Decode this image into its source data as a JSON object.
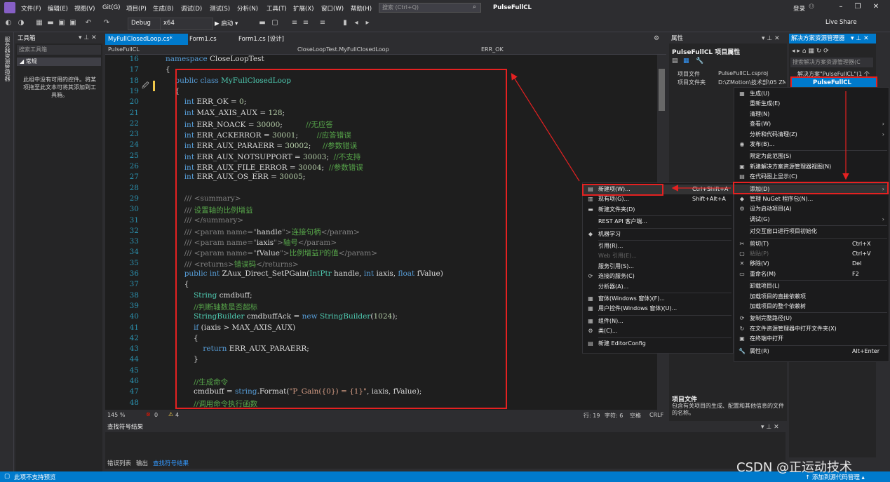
{
  "menubar": {
    "items": [
      "文件(F)",
      "编辑(E)",
      "视图(V)",
      "Git(G)",
      "项目(P)",
      "生成(B)",
      "调试(D)",
      "测试(S)",
      "分析(N)",
      "工具(T)",
      "扩展(X)",
      "窗口(W)",
      "帮助(H)"
    ],
    "search_placeholder": "搜索 (Ctrl+Q)",
    "title": "PulseFullCL",
    "login": "登录"
  },
  "toolbar": {
    "config": "Debug",
    "platform": "x64",
    "start": "▶ 启动 ▾",
    "liveshare": "Live Share"
  },
  "left_strip": {
    "label": "服务器资源管理器"
  },
  "toolbox": {
    "title": "工具箱",
    "search": "搜索工具箱",
    "group": "◢ 常规",
    "empty": "此组中没有可用的控件。将某项拖至此文本可将其添加到工具箱。"
  },
  "editor": {
    "tabs": [
      "MyFullClosedLoop.cs*",
      "Form1.cs",
      "Form1.cs [设计]"
    ],
    "nav": [
      "PulseFullCL",
      "CloseLoopTest.MyFullClosedLoop",
      "ERR_OK"
    ],
    "zoom": "145 %",
    "errors": "0",
    "warnings": "4",
    "row": "行: 19",
    "col": "字符: 6",
    "space": "空格",
    "crlf": "CRLF",
    "line_numbers": [
      "16",
      "17",
      "18",
      "19",
      "20",
      "21",
      "22",
      "23",
      "24",
      "25",
      "26",
      "27",
      "28",
      "29",
      "30",
      "31",
      "32",
      "33",
      "34",
      "35",
      "36",
      "37",
      "38",
      "39",
      "40",
      "41",
      "42",
      "43",
      "44",
      "45",
      "46",
      "47",
      "48"
    ]
  },
  "find_panel": {
    "title": "查找符号结果",
    "tabs": [
      "错误列表",
      "输出",
      "查找符号结果"
    ]
  },
  "properties": {
    "title": "属性",
    "object": "PulseFullCL 项目属性",
    "rows": [
      {
        "k": "项目文件",
        "v": "PulseFullCL.csproj"
      },
      {
        "k": "项目文件夹",
        "v": "D:\\ZMotion\\技术部\\05 ZM"
      }
    ],
    "desc_title": "项目文件",
    "desc_text": "包含有关项目的生成、配置和其他信息的文件的名称。"
  },
  "solution": {
    "title": "解决方案资源管理器",
    "search": "搜索解决方案资源管理器(C",
    "solution_node": "解决方案\"PulseFullCL\"(1 个",
    "project_node": "PulseFullCL"
  },
  "context_menu": {
    "items": [
      {
        "icon": "▦",
        "label": "生成(U)",
        "shortcut": ""
      },
      {
        "icon": "",
        "label": "重新生成(E)",
        "shortcut": ""
      },
      {
        "icon": "",
        "label": "清理(N)",
        "shortcut": ""
      },
      {
        "icon": "",
        "label": "查看(W)",
        "shortcut": ""
      },
      {
        "icon": "",
        "label": "分析和代码清理(Z)",
        "shortcut": ""
      },
      {
        "icon": "◉",
        "label": "发布(B)...",
        "shortcut": ""
      },
      {
        "icon": "",
        "label": "限定为此范围(S)",
        "shortcut": ""
      },
      {
        "icon": "▣",
        "label": "新建解决方案资源管理器视图(N)",
        "shortcut": ""
      },
      {
        "icon": "▤",
        "label": "在代码图上显示(C)",
        "shortcut": ""
      },
      {
        "icon": "",
        "label": "添加(D)",
        "shortcut": ""
      },
      {
        "icon": "◆",
        "label": "管理 NuGet 程序包(N)...",
        "shortcut": ""
      },
      {
        "icon": "⚙",
        "label": "设为启动项目(A)",
        "shortcut": ""
      },
      {
        "icon": "",
        "label": "调试(G)",
        "shortcut": ""
      },
      {
        "icon": "",
        "label": "对交互窗口进行项目初始化",
        "shortcut": ""
      },
      {
        "icon": "✂",
        "label": "剪切(T)",
        "shortcut": "Ctrl+X"
      },
      {
        "icon": "▢",
        "label": "粘贴(P)",
        "shortcut": "Ctrl+V"
      },
      {
        "icon": "✕",
        "label": "移除(V)",
        "shortcut": "Del"
      },
      {
        "icon": "▭",
        "label": "重命名(M)",
        "shortcut": "F2"
      },
      {
        "icon": "",
        "label": "卸载项目(L)",
        "shortcut": ""
      },
      {
        "icon": "",
        "label": "加载项目的直接依赖项",
        "shortcut": ""
      },
      {
        "icon": "",
        "label": "加载项目的整个依赖树",
        "shortcut": ""
      },
      {
        "icon": "⟳",
        "label": "复制完整路径(U)",
        "shortcut": ""
      },
      {
        "icon": "↻",
        "label": "在文件资源管理器中打开文件夹(X)",
        "shortcut": ""
      },
      {
        "icon": "▣",
        "label": "在终端中打开",
        "shortcut": ""
      },
      {
        "icon": "🔧",
        "label": "属性(R)",
        "shortcut": "Alt+Enter"
      }
    ]
  },
  "add_menu": {
    "items": [
      {
        "icon": "▤",
        "label": "新建项(W)...",
        "shortcut": "Ctrl+Shift+A"
      },
      {
        "icon": "▥",
        "label": "现有项(G)...",
        "shortcut": "Shift+Alt+A"
      },
      {
        "icon": "▬",
        "label": "新建文件夹(D)",
        "shortcut": ""
      },
      {
        "icon": "",
        "label": "REST API 客户端...",
        "shortcut": ""
      },
      {
        "icon": "◆",
        "label": "机器学习",
        "shortcut": ""
      },
      {
        "icon": "",
        "label": "引用(R)...",
        "shortcut": ""
      },
      {
        "icon": "",
        "label": "Web 引用(E)...",
        "shortcut": ""
      },
      {
        "icon": "",
        "label": "服务引用(S)...",
        "shortcut": ""
      },
      {
        "icon": "⟳",
        "label": "连接的服务(C)",
        "shortcut": ""
      },
      {
        "icon": "",
        "label": "分析器(A)...",
        "shortcut": ""
      },
      {
        "icon": "▦",
        "label": "窗体(Windows 窗体)(F)...",
        "shortcut": ""
      },
      {
        "icon": "▦",
        "label": "用户控件(Windows 窗体)(U)...",
        "shortcut": ""
      },
      {
        "icon": "▦",
        "label": "组件(N)...",
        "shortcut": ""
      },
      {
        "icon": "⚙",
        "label": "类(C)...",
        "shortcut": ""
      },
      {
        "icon": "▤",
        "label": "新建 EditorConfig",
        "shortcut": ""
      }
    ]
  },
  "statusbar": {
    "left": "此项不支持预览",
    "right": "↑ 添加到源代码管理 ▴"
  },
  "watermark": "CSDN @正运动技术"
}
